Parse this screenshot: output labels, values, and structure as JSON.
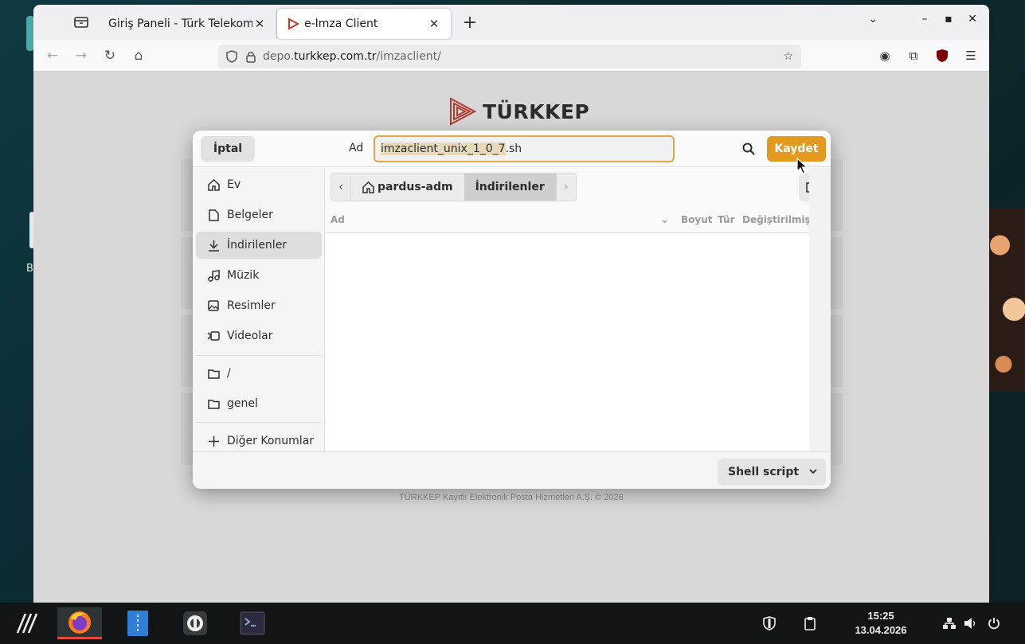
{
  "desktop": {
    "partial_label": "B"
  },
  "browser": {
    "tabs": [
      {
        "title": "Giriş Paneli - Türk Telekom",
        "active": false
      },
      {
        "title": "e-İmza Client",
        "active": true
      }
    ],
    "url": {
      "host_prefix": "depo.",
      "host_main": "turkkep.com.tr",
      "path": "/imzaclient/"
    },
    "page": {
      "logo_text": "TÜRKKEP",
      "footer": "TÜRKKEP Kayıtlı Elektronik Posta Hizmetleri A.Ş. © 2026"
    }
  },
  "dialog": {
    "cancel_label": "İptal",
    "name_label": "Ad",
    "filename_selected": "imzaclient_unix_1_0_7",
    "filename_ext": ".sh",
    "save_label": "Kaydet",
    "sidebar": {
      "items": [
        {
          "label": "Ev",
          "icon": "home-icon",
          "selected": false
        },
        {
          "label": "Belgeler",
          "icon": "document-icon",
          "selected": false
        },
        {
          "label": "İndirilenler",
          "icon": "download-icon",
          "selected": true
        },
        {
          "label": "Müzik",
          "icon": "music-icon",
          "selected": false
        },
        {
          "label": "Resimler",
          "icon": "image-icon",
          "selected": false
        },
        {
          "label": "Videolar",
          "icon": "video-icon",
          "selected": false
        }
      ],
      "places": [
        {
          "label": "/",
          "icon": "folder-icon"
        },
        {
          "label": "genel",
          "icon": "folder-icon"
        }
      ],
      "other_locations": "Diğer Konumlar"
    },
    "path": [
      {
        "label": "pardus-adm",
        "icon": "home-icon"
      },
      {
        "label": "İndirilenler",
        "current": true
      }
    ],
    "columns": {
      "name": "Ad",
      "size": "Boyut",
      "type": "Tür",
      "modified": "Değiştirilmiş"
    },
    "file_type_filter": "Shell script"
  },
  "taskbar": {
    "apps": [
      "pardus-menu",
      "firefox",
      "file-manager",
      "app-o",
      "terminal"
    ],
    "time": "15:25",
    "date": "13.04.2026"
  },
  "colors": {
    "accent": "#e49a1f",
    "input_border": "#e0a64a",
    "taskbar": "#111516"
  }
}
